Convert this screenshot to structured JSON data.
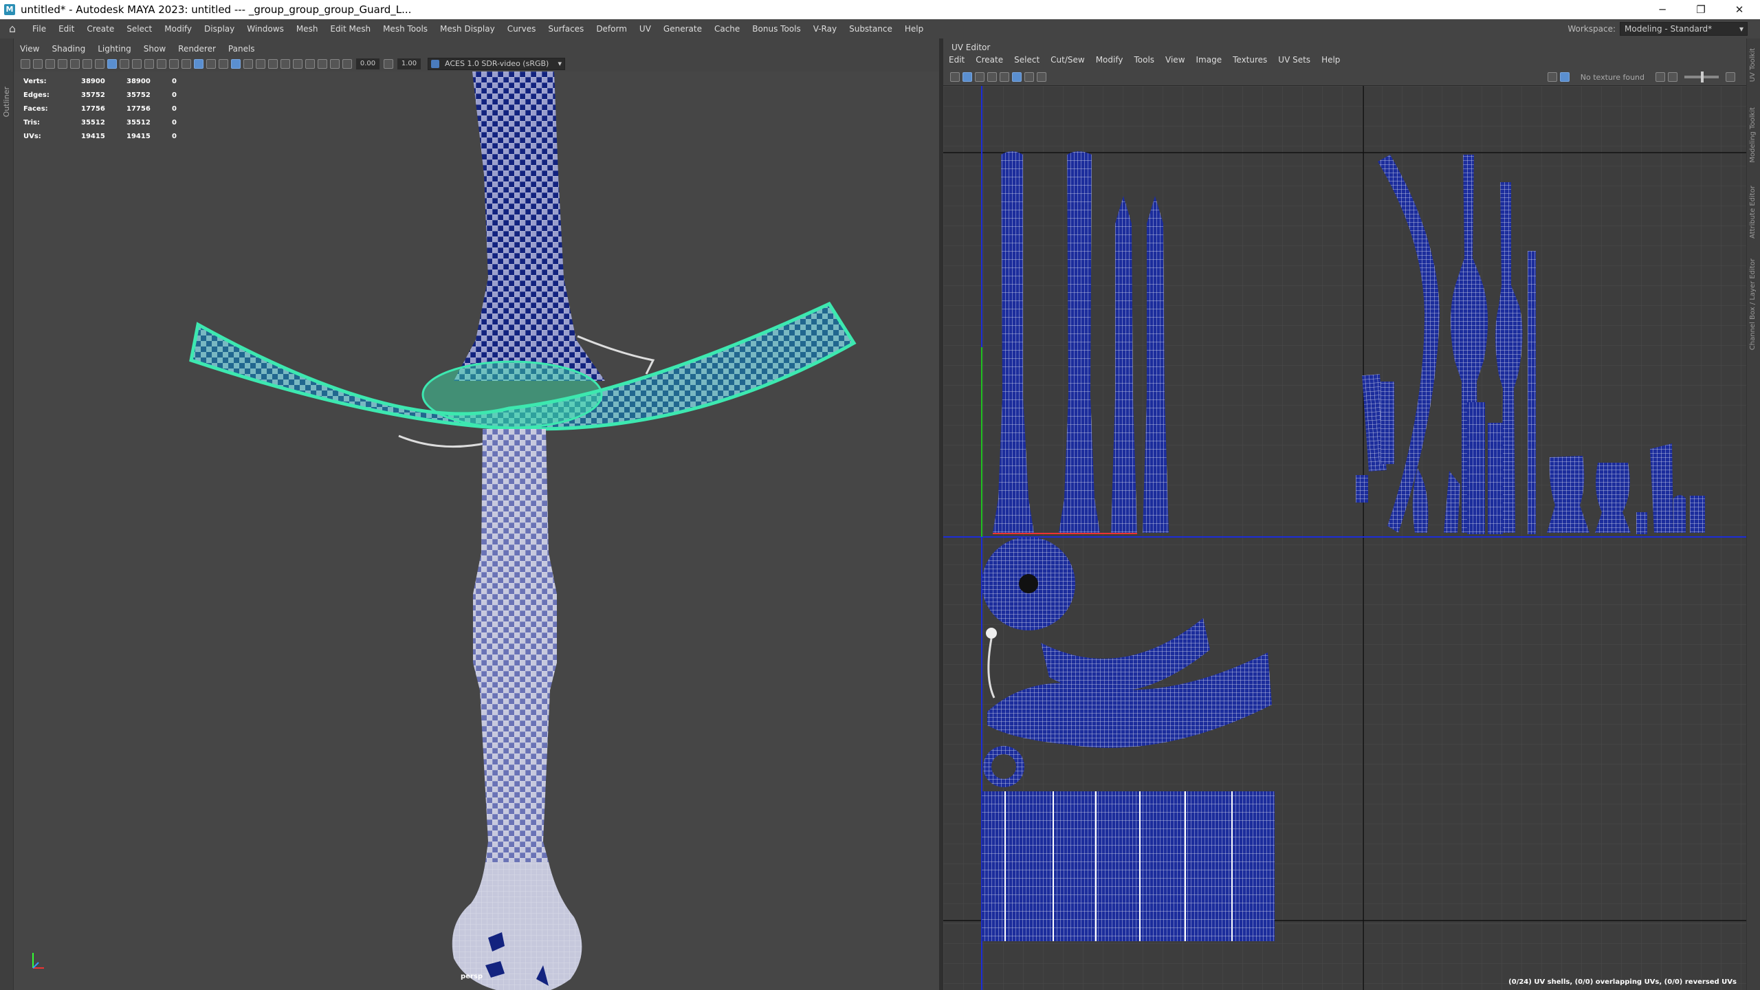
{
  "window": {
    "title": "untitled* - Autodesk MAYA 2023: untitled   ---   _group_group_group_Guard_L...",
    "app_icon": "M",
    "controls": [
      "─",
      "❐",
      "✕"
    ]
  },
  "menubar": {
    "items": [
      "File",
      "Edit",
      "Create",
      "Select",
      "Modify",
      "Display",
      "Windows",
      "Mesh",
      "Edit Mesh",
      "Mesh Tools",
      "Mesh Display",
      "Curves",
      "Surfaces",
      "Deform",
      "UV",
      "Generate",
      "Cache",
      "Bonus Tools",
      "V-Ray",
      "Substance",
      "Help"
    ]
  },
  "workspace": {
    "label": "Workspace:",
    "value": "Modeling - Standard*"
  },
  "left_strip": {
    "label": "Outliner"
  },
  "viewport": {
    "menu": [
      "View",
      "Shading",
      "Lighting",
      "Show",
      "Renderer",
      "Panels"
    ],
    "toolbar": {
      "near": "0.00",
      "far": "1.00",
      "colorspace": "ACES 1.0 SDR-video (sRGB)"
    },
    "hud": [
      {
        "label": "Verts:",
        "a": "38900",
        "b": "38900",
        "c": "0"
      },
      {
        "label": "Edges:",
        "a": "35752",
        "b": "35752",
        "c": "0"
      },
      {
        "label": "Faces:",
        "a": "17756",
        "b": "17756",
        "c": "0"
      },
      {
        "label": "Tris:",
        "a": "35512",
        "b": "35512",
        "c": "0"
      },
      {
        "label": "UVs:",
        "a": "19415",
        "b": "19415",
        "c": "0"
      }
    ],
    "camera": "persp"
  },
  "uv_editor": {
    "title": "UV Editor",
    "menu": [
      "Edit",
      "Create",
      "Select",
      "Cut/Sew",
      "Modify",
      "Tools",
      "View",
      "Image",
      "Textures",
      "UV Sets",
      "Help"
    ],
    "texture_status": "No texture found",
    "status": "(0/24) UV shells, (0/0) overlapping UVs, (0/0) reversed UVs"
  },
  "right_strip": [
    "UV Toolkit",
    "Modeling Toolkit",
    "Attribute Editor",
    "Channel Box / Layer Editor"
  ],
  "colors": {
    "selection": "#3de8b0",
    "uv_blue": "#1c2d9c",
    "checker_dark": "#13237f",
    "background": "#464646"
  }
}
